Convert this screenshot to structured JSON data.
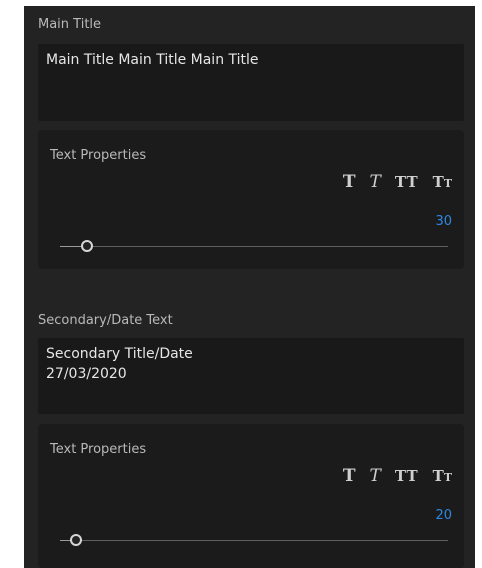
{
  "main_title": {
    "label": "Main Title",
    "text": "Main Title Main Title Main Title",
    "properties": {
      "label": "Text Properties",
      "styles": [
        "T",
        "T",
        "TT",
        "Tт"
      ],
      "size": 30,
      "slider_fraction": 0.07
    }
  },
  "secondary": {
    "label": "Secondary/Date Text",
    "text": "Secondary Title/Date\n27/03/2020",
    "properties": {
      "label": "Text Properties",
      "styles": [
        "T",
        "T",
        "TT",
        "Tт"
      ],
      "size": 20,
      "slider_fraction": 0.04
    }
  }
}
